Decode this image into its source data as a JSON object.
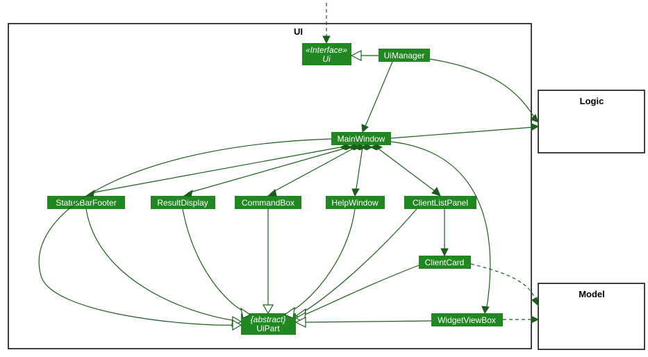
{
  "diagram": "UML class diagram",
  "package": {
    "name": "UI"
  },
  "external": {
    "logic": "Logic",
    "model": "Model"
  },
  "classes": {
    "ui_interface": {
      "stereotype": "«Interface»",
      "name": "Ui"
    },
    "ui_manager": "UiManager",
    "main_window": "MainWindow",
    "status_bar_footer": "StatusBarFooter",
    "result_display": "ResultDisplay",
    "command_box": "CommandBox",
    "help_window": "HelpWindow",
    "client_list_panel": "ClientListPanel",
    "client_card": "ClientCard",
    "widget_view_box": "WidgetViewBox",
    "ui_part": {
      "stereotype": "{abstract}",
      "name": "UiPart"
    }
  },
  "edges": [
    {
      "from": "external-top",
      "to": "Ui",
      "style": "dashed-arrow"
    },
    {
      "from": "UiManager",
      "to": "Ui",
      "style": "open-triangle (realization)"
    },
    {
      "from": "UiManager",
      "to": "MainWindow",
      "style": "solid-arrow"
    },
    {
      "from": "UiManager",
      "to": "Logic",
      "style": "solid-arrow (curved)"
    },
    {
      "from": "MainWindow",
      "to": "Logic",
      "style": "solid-arrow"
    },
    {
      "from": "MainWindow",
      "to": "StatusBarFooter",
      "style": "composition"
    },
    {
      "from": "MainWindow",
      "to": "ResultDisplay",
      "style": "composition"
    },
    {
      "from": "MainWindow",
      "to": "CommandBox",
      "style": "composition"
    },
    {
      "from": "MainWindow",
      "to": "HelpWindow",
      "style": "composition"
    },
    {
      "from": "MainWindow",
      "to": "ClientListPanel",
      "style": "composition"
    },
    {
      "from": "MainWindow",
      "to": "WidgetViewBox",
      "style": "solid curve"
    },
    {
      "from": "ClientListPanel",
      "to": "ClientCard",
      "style": "solid-arrow"
    },
    {
      "from": "StatusBarFooter",
      "to": "UiPart",
      "style": "open-triangle (inherit)"
    },
    {
      "from": "ResultDisplay",
      "to": "UiPart",
      "style": "open-triangle"
    },
    {
      "from": "CommandBox",
      "to": "UiPart",
      "style": "open-triangle"
    },
    {
      "from": "HelpWindow",
      "to": "UiPart",
      "style": "open-triangle"
    },
    {
      "from": "ClientListPanel",
      "to": "UiPart",
      "style": "open-triangle"
    },
    {
      "from": "ClientCard",
      "to": "UiPart",
      "style": "open-triangle"
    },
    {
      "from": "MainWindow",
      "to": "UiPart",
      "style": "open-triangle (curved left)"
    },
    {
      "from": "WidgetViewBox",
      "to": "UiPart",
      "style": "open-triangle"
    },
    {
      "from": "ClientCard",
      "to": "Model",
      "style": "dashed-arrow (curved)"
    },
    {
      "from": "WidgetViewBox",
      "to": "Model",
      "style": "dashed-arrow"
    }
  ]
}
